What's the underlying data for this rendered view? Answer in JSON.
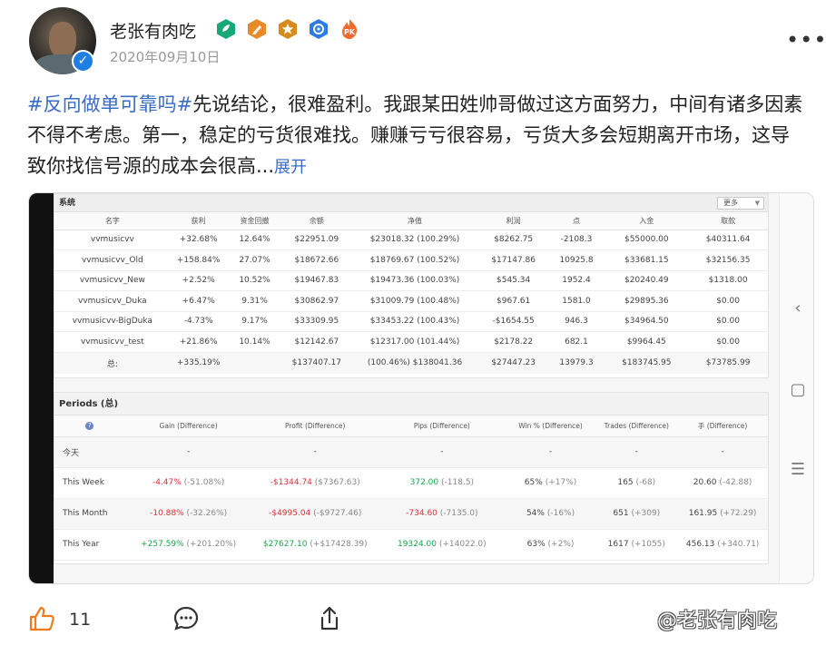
{
  "post": {
    "author": "老张有肉吃",
    "date": "2020年09月10日",
    "hashtag": "#反向做单可靠吗#",
    "body": "先说结论，很难盈利。我跟某田姓帅哥做过这方面努力，中间有诸多因素不得不考虑。第一，稳定的亏货很难找。赚赚亏亏很容易，亏货大多会短期离开市场，这导致你找信号源的成本会很高...",
    "expand_label": "展开",
    "badges": [
      "leaf-badge-icon",
      "pen-badge-icon",
      "star-badge-icon",
      "shield-badge-icon",
      "pk-badge-icon"
    ],
    "colors": {
      "link": "#3a6cc7",
      "positive": "#1ca54a",
      "negative": "#e0303a"
    }
  },
  "accounts": {
    "title": "系统",
    "more_label": "更多",
    "headers": [
      "名字",
      "获利",
      "资金回撤",
      "余额",
      "净值",
      "利润",
      "点",
      "入金",
      "取款"
    ],
    "rows": [
      [
        "vvmusicvv",
        "+32.68%",
        "12.64%",
        "$22951.09",
        "$23018.32 (100.29%)",
        "$8262.75",
        "-2108.3",
        "$55000.00",
        "$40311.64"
      ],
      [
        "vvmusicvv_Old",
        "+158.84%",
        "27.07%",
        "$18672.66",
        "$18769.67 (100.52%)",
        "$17147.86",
        "10925.8",
        "$33681.15",
        "$32156.35"
      ],
      [
        "vvmusicvv_New",
        "+2.52%",
        "10.52%",
        "$19467.83",
        "$19473.36 (100.03%)",
        "$545.34",
        "1952.4",
        "$20240.49",
        "$1318.00"
      ],
      [
        "vvmusicvv_Duka",
        "+6.47%",
        "9.31%",
        "$30862.97",
        "$31009.79 (100.48%)",
        "$967.61",
        "1581.0",
        "$29895.36",
        "$0.00"
      ],
      [
        "vvmusicvv-BigDuka",
        "-4.73%",
        "9.17%",
        "$33309.95",
        "$33453.22 (100.43%)",
        "-$1654.55",
        "946.3",
        "$34964.50",
        "$0.00"
      ],
      [
        "vvmusicvv_test",
        "+21.86%",
        "10.14%",
        "$12142.67",
        "$12317.00 (101.44%)",
        "$2178.22",
        "682.1",
        "$9964.45",
        "$0.00"
      ]
    ],
    "total": [
      "总:",
      "+335.19%",
      "",
      "$137407.17",
      "(100.46%) $138041.36",
      "$27447.23",
      "13979.3",
      "$183745.95",
      "$73785.99"
    ]
  },
  "periods": {
    "title": "Periods (总)",
    "help_glyph": "?",
    "headers": [
      "Gain (Difference)",
      "Profit (Difference)",
      "Pips (Difference)",
      "Win % (Difference)",
      "Trades (Difference)",
      "手 (Difference)"
    ],
    "rows": [
      {
        "label": "今天",
        "cells": [
          [
            "-",
            ""
          ],
          [
            "-",
            ""
          ],
          [
            "-",
            ""
          ],
          [
            "-",
            ""
          ],
          [
            "-",
            ""
          ],
          [
            "-",
            ""
          ]
        ]
      },
      {
        "label": "This Week",
        "cells": [
          [
            "-4.47%",
            "(-51.08%)"
          ],
          [
            "-$1344.74",
            "($7367.63)"
          ],
          [
            "372.00",
            "(-118.5)"
          ],
          [
            "65%",
            "(+17%)"
          ],
          [
            "165",
            "(-68)"
          ],
          [
            "20.60",
            "(-42.88)"
          ]
        ]
      },
      {
        "label": "This Month",
        "cells": [
          [
            "-10.88%",
            "(-32.26%)"
          ],
          [
            "-$4995.04",
            "(-$9727.46)"
          ],
          [
            "-734.60",
            "(-7135.0)"
          ],
          [
            "54%",
            "(-16%)"
          ],
          [
            "651",
            "(+309)"
          ],
          [
            "161.95",
            "(+72.29)"
          ]
        ]
      },
      {
        "label": "This Year",
        "cells": [
          [
            "+257.59%",
            "(+201.20%)"
          ],
          [
            "$27627.10",
            "(+$17428.39)"
          ],
          [
            "19324.00",
            "(+14022.0)"
          ],
          [
            "63%",
            "(+2%)"
          ],
          [
            "1617",
            "(+1055)"
          ],
          [
            "456.13",
            "(+340.71)"
          ]
        ]
      }
    ]
  },
  "footer": {
    "like_count": "11",
    "watermark": "@老张有肉吃"
  }
}
